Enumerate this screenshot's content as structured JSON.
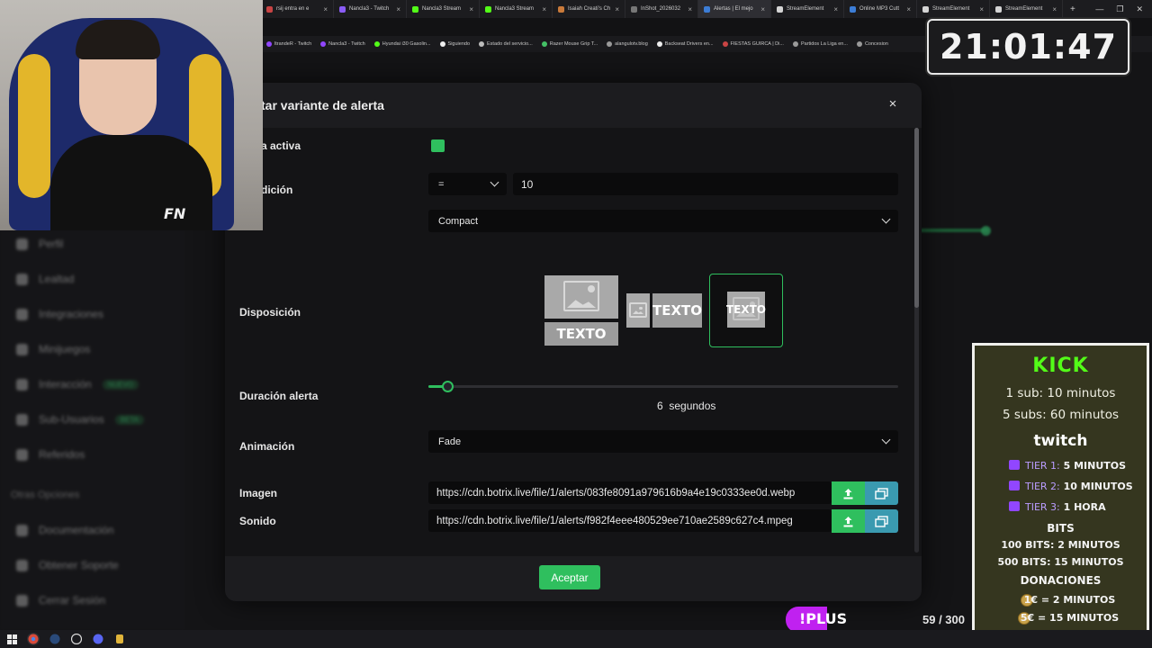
{
  "browser": {
    "tabs": [
      {
        "label": "rsij entra en e"
      },
      {
        "label": "Nancla3 - Twitch"
      },
      {
        "label": "Nancla3 Stream"
      },
      {
        "label": "Nancla3 Stream"
      },
      {
        "label": "Isaiah Creati's Ch"
      },
      {
        "label": "InShot_2026032"
      },
      {
        "label": "Alertas | El mejo"
      },
      {
        "label": "StreamElement"
      },
      {
        "label": "Online MP3 Cutt"
      },
      {
        "label": "StreamElement"
      },
      {
        "label": "StreamElement"
      }
    ],
    "active_tab": 6,
    "bookmarks": [
      "ltrandeR - Twitch",
      "Nancla3 - Twitch",
      "Hyundai i30 Gasolin...",
      "Siguiendo",
      "Estado del servicio...",
      "Razer Mouse Grip T...",
      "alangulotv.blog",
      "Backseat Drivers en...",
      "FIESTAS GUIRCA | Di...",
      "Partidos La Liga en...",
      "Concesion"
    ]
  },
  "sidebar": {
    "items": [
      {
        "label": "Perfil"
      },
      {
        "label": "Lealtad"
      },
      {
        "label": "Integraciones"
      },
      {
        "label": "Minijuegos"
      },
      {
        "label": "Interacción",
        "badge": "NUEVO"
      },
      {
        "label": "Sub-Usuarios",
        "badge": "BETA"
      },
      {
        "label": "Referidos"
      }
    ],
    "section": "Otras Opciones",
    "extra": [
      {
        "label": "Documentación"
      },
      {
        "label": "Obtener Soporte"
      },
      {
        "label": "Cerrar Sesión"
      }
    ]
  },
  "modal": {
    "title": "tar variante de alerta",
    "close_label": "×",
    "fields": {
      "active_label": "a activa",
      "condition_label": "dición",
      "condition_operator": "=",
      "condition_value": "10",
      "style_label": "o",
      "style_value": "Compact",
      "layout_label": "Disposición",
      "layout_text": "TEXTO",
      "duration_label": "Duración alerta",
      "duration_value": "6",
      "duration_unit": "segundos",
      "duration_fraction": 0.04,
      "animation_label": "Animación",
      "animation_value": "Fade",
      "image_label": "Imagen",
      "image_url": "https://cdn.botrix.live/file/1/alerts/083fe8091a979616b9a4e19c0333ee0d.webp",
      "sound_label": "Sonido",
      "sound_url": "https://cdn.botrix.live/file/1/alerts/f982f4eee480529ee710ae2589c627c4.mpeg"
    },
    "accept_label": "Aceptar"
  },
  "clock": "21:01:47",
  "subs_panel": {
    "kick_title": "KICK",
    "kick_lines": [
      "1 sub: 10 minutos",
      "5 subs: 60 minutos"
    ],
    "twitch_title": "twitch",
    "tiers": [
      {
        "name": "TIER 1:",
        "reward": "5 MINUTOS"
      },
      {
        "name": "TIER 2:",
        "reward": "10 MINUTOS"
      },
      {
        "name": "TIER 3:",
        "reward": "1 HORA"
      }
    ],
    "bits_title": "BITS",
    "bits_lines": [
      "100 BITS: 2 MINUTOS",
      "500 BITS: 15 MINUTOS"
    ],
    "donations_title": "DONACIONES",
    "donation_lines": [
      "1€ = 2 MINUTOS",
      "5€ = 15 MINUTOS"
    ]
  },
  "plus_label": "!PLUS",
  "counter": "59 / 300",
  "colors": {
    "accent_green": "#2fbf5e",
    "gallery_blue": "#3a9ab0",
    "kick_green": "#53fc18",
    "twitch_purple": "#9146ff"
  }
}
